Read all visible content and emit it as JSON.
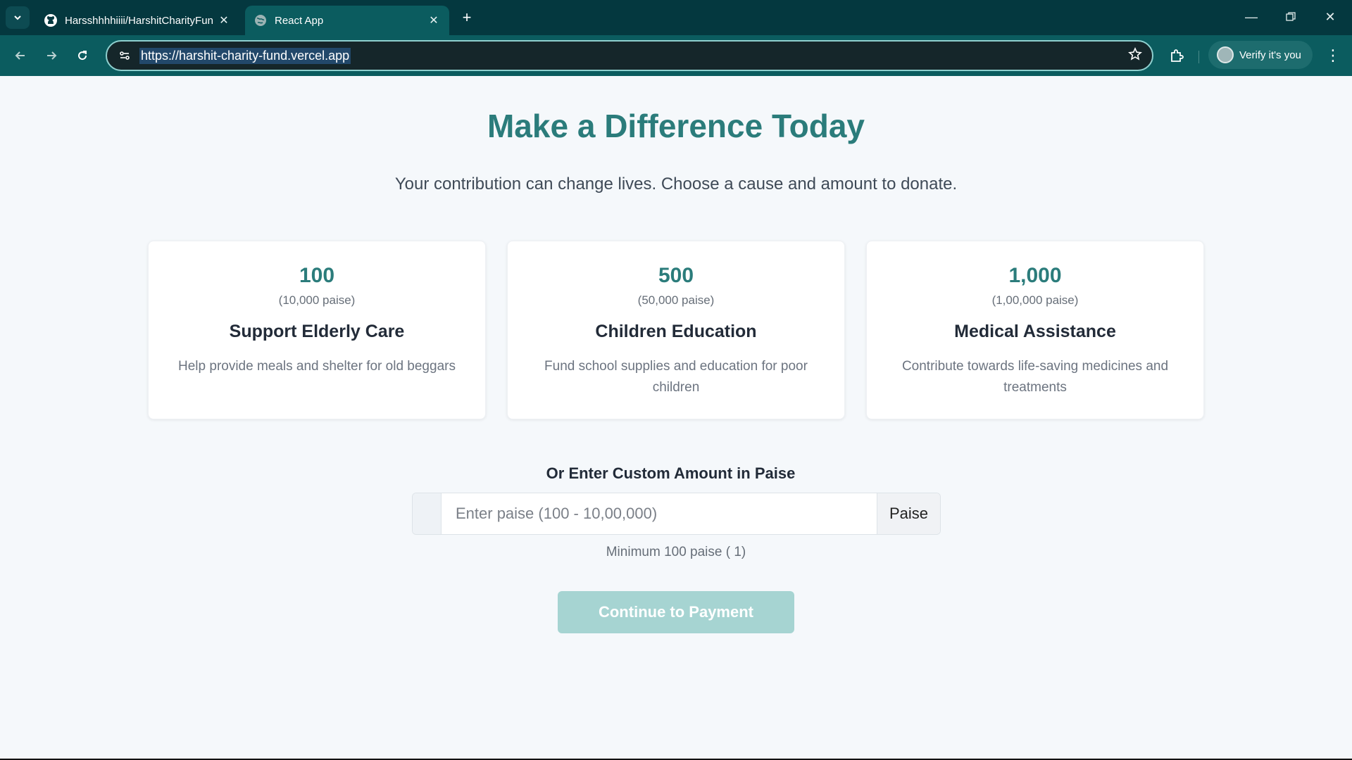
{
  "browser": {
    "tabs": [
      {
        "title": "Harsshhhhiiii/HarshitCharityFun",
        "icon": "github-icon"
      },
      {
        "title": "React App",
        "icon": "globe-icon"
      }
    ],
    "url": "https://harshit-charity-fund.vercel.app",
    "profile_label": "Verify it's you",
    "colors": {
      "tabbar": "#04383f",
      "toolbar": "#0b5c5f"
    }
  },
  "page": {
    "heading": "Make a Difference Today",
    "subtitle": "Your contribution can change lives. Choose a cause and amount to donate.",
    "cards": [
      {
        "amount": "100",
        "paise": "(10,000 paise)",
        "cause": "Support Elderly Care",
        "desc": "Help provide meals and shelter for old beggars"
      },
      {
        "amount": "500",
        "paise": "(50,000 paise)",
        "cause": "Children Education",
        "desc": "Fund school supplies and education for poor children"
      },
      {
        "amount": "1,000",
        "paise": "(1,00,000 paise)",
        "cause": "Medical Assistance",
        "desc": "Contribute towards life-saving medicines and treatments"
      }
    ],
    "custom_label": "Or Enter Custom Amount in Paise",
    "input_placeholder": "Enter paise (100 - 10,00,000)",
    "input_suffix": "Paise",
    "hint": "Minimum 100 paise ( 1)",
    "pay_button": "Continue to Payment",
    "colors": {
      "accent": "#2b7c7b",
      "button_disabled": "#a6d4d2",
      "background": "#f5f8fb"
    }
  }
}
